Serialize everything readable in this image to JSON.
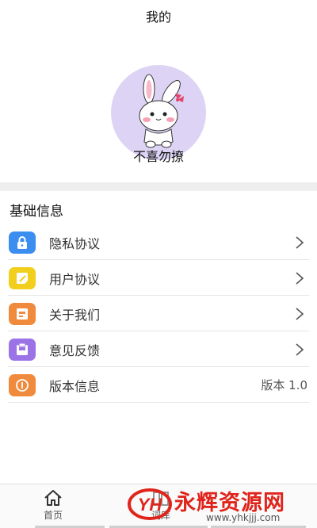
{
  "header": {
    "title": "我的"
  },
  "profile": {
    "username": "不喜勿撩",
    "avatar_icon": "bunny-avatar-icon",
    "avatar_bg": "#ddd4f5"
  },
  "section": {
    "title": "基础信息"
  },
  "menu": {
    "items": [
      {
        "label": "隐私协议",
        "icon": "lock-icon",
        "color": "#3b8ef0",
        "trailing": "chevron"
      },
      {
        "label": "用户协议",
        "icon": "note-edit-icon",
        "color": "#f2cf1d",
        "trailing": "chevron"
      },
      {
        "label": "关于我们",
        "icon": "id-card-icon",
        "color": "#f08a3c",
        "trailing": "chevron"
      },
      {
        "label": "意见反馈",
        "icon": "feedback-box-icon",
        "color": "#9b73e6",
        "trailing": "chevron"
      },
      {
        "label": "版本信息",
        "icon": "info-circle-icon",
        "color": "#f08a3c",
        "value": "版本 1.0"
      }
    ]
  },
  "tabbar": {
    "tabs": [
      {
        "label": "首页",
        "icon": "home-icon"
      },
      {
        "label": "词库",
        "icon": "library-icon"
      }
    ]
  },
  "watermark": {
    "logo_text": "YH",
    "text": "永辉资源网",
    "url": "www.yhkjjj.com"
  }
}
